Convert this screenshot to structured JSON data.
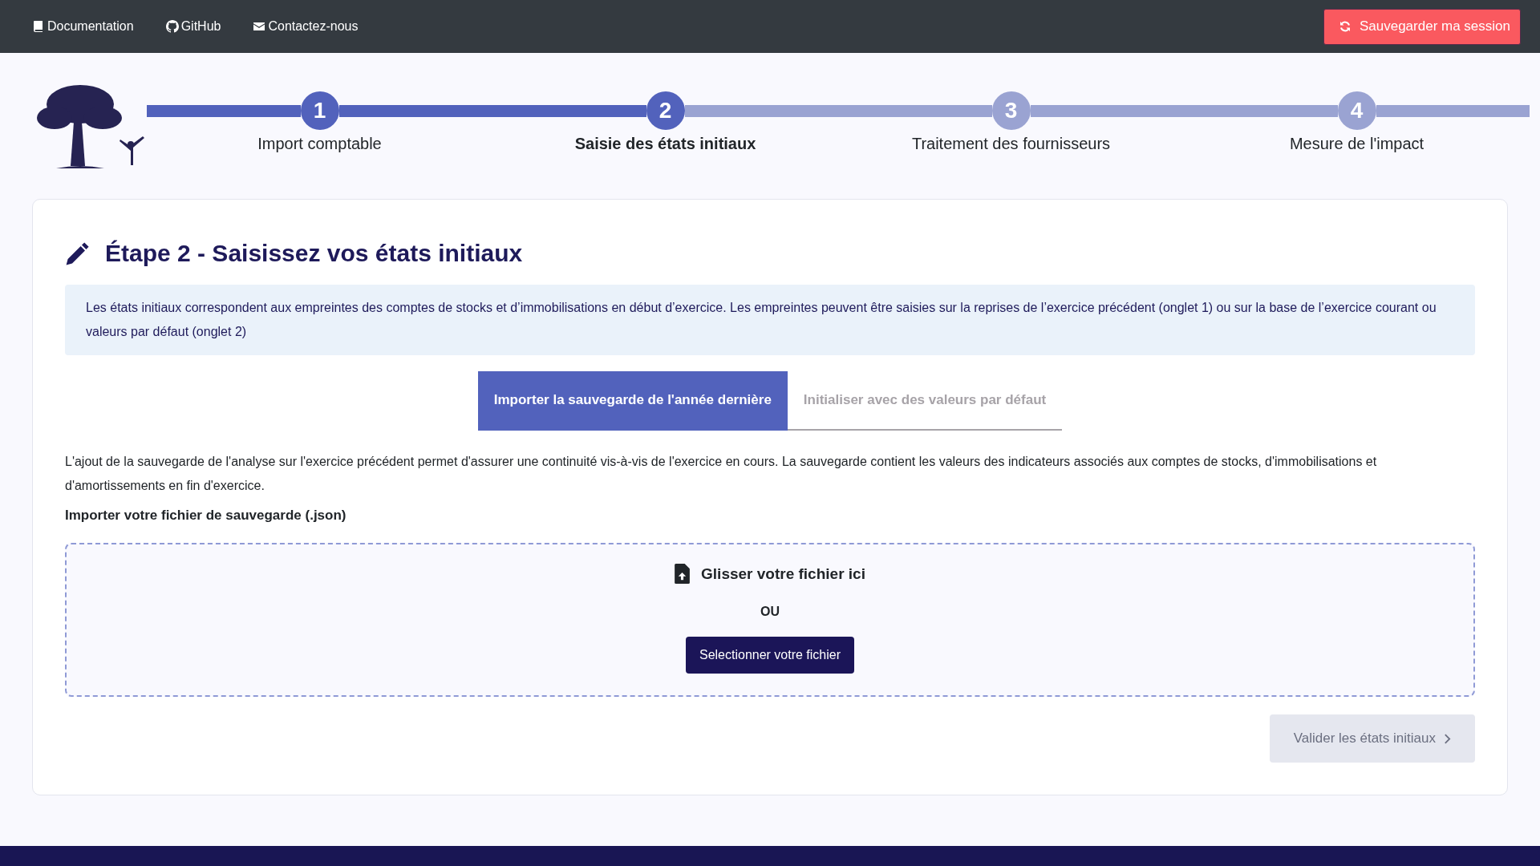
{
  "nav": {
    "links": [
      {
        "kind": "book",
        "label": "Documentation"
      },
      {
        "kind": "github",
        "label": "GitHub"
      },
      {
        "kind": "mail",
        "label": "Contactez-nous"
      }
    ],
    "save_button": "Sauvegarder ma session"
  },
  "stepper": {
    "steps": [
      {
        "number": "1",
        "label": "Import comptable",
        "completed": true,
        "selected": false
      },
      {
        "number": "2",
        "label": "Saisie des états initiaux",
        "completed": false,
        "selected": true
      },
      {
        "number": "3",
        "label": "Traitement des fournisseurs",
        "completed": false,
        "selected": false
      },
      {
        "number": "4",
        "label": "Mesure de l'impact",
        "completed": false,
        "selected": false
      }
    ]
  },
  "card": {
    "title": "Étape 2 - Saisissez vos états initiaux",
    "info": "Les états initiaux correspondent aux empreintes des comptes de stocks et d’immobilisations en début d’exercice. Les empreintes peuvent être saisies sur la reprises de l’exercice précédent (onglet 1) ou sur la base de l’exercice courant ou valeurs par défaut (onglet 2)",
    "tabs": [
      {
        "label": "Importer la sauvegarde de l'année dernière",
        "selected": true
      },
      {
        "label": "Initialiser avec des valeurs par défaut",
        "selected": false
      }
    ],
    "description": "L'ajout de la sauvegarde de l'analyse sur l'exercice précédent permet d'assurer une continuité vis-à-vis de l'exercice en cours. La sauvegarde contient les valeurs des indicateurs associés aux comptes de stocks, d'immobilisations et d'amortissements en fin d'exercice.",
    "upload_label": "Importer votre fichier de sauvegarde (.json)",
    "dropzone": {
      "drop_text": "Glisser votre fichier ici",
      "or_text": "OU",
      "select_button": "Selectionner votre fichier"
    },
    "validate_button": {
      "label": "Valider les états initiaux",
      "disabled": true
    }
  }
}
